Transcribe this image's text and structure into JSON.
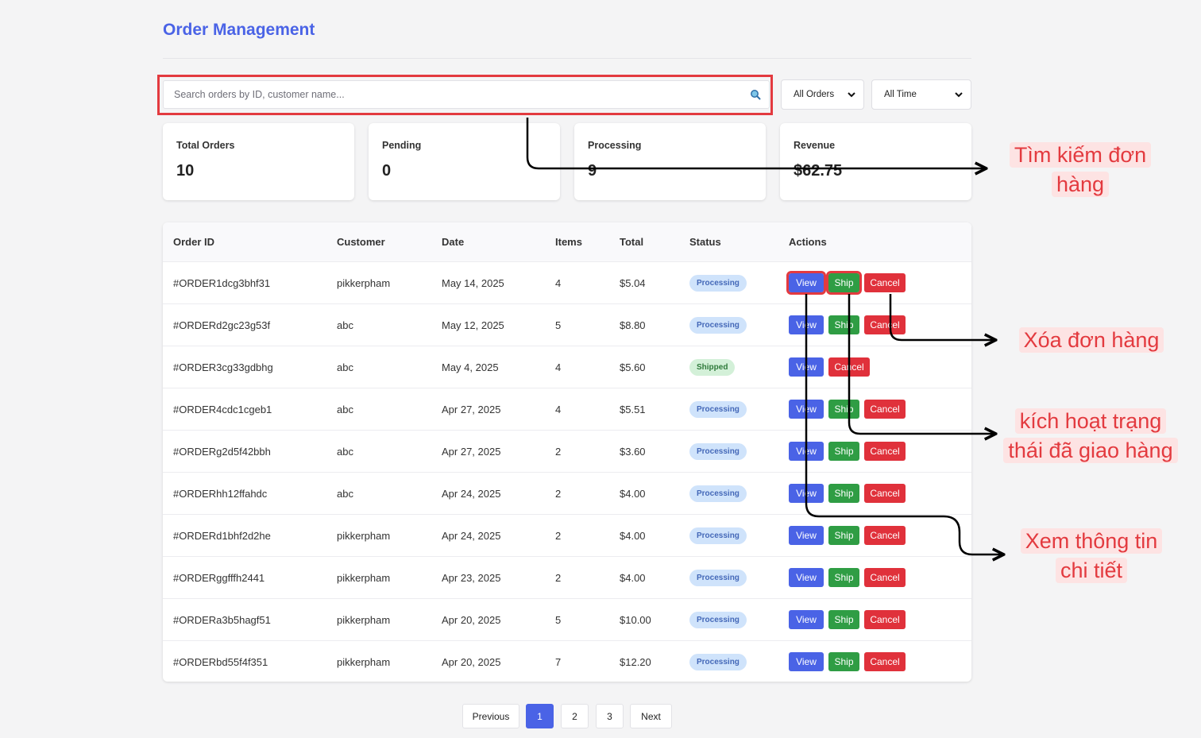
{
  "page": {
    "title": "Order Management"
  },
  "search": {
    "placeholder": "Search orders by ID, customer name...",
    "value": ""
  },
  "filters": {
    "status": "All Orders",
    "time": "All Time"
  },
  "stats": [
    {
      "label": "Total Orders",
      "value": "10"
    },
    {
      "label": "Pending",
      "value": "0"
    },
    {
      "label": "Processing",
      "value": "9"
    },
    {
      "label": "Revenue",
      "value": "$62.75"
    }
  ],
  "table": {
    "columns": [
      "Order ID",
      "Customer",
      "Date",
      "Items",
      "Total",
      "Status",
      "Actions"
    ],
    "actions": {
      "view": "View",
      "ship": "Ship",
      "cancel": "Cancel"
    },
    "rows": [
      {
        "id": "#ORDER1dcg3bhf31",
        "customer": "pikkerpham",
        "date": "May 14, 2025",
        "items": "4",
        "total": "$5.04",
        "status": "Processing"
      },
      {
        "id": "#ORDERd2gc23g53f",
        "customer": "abc",
        "date": "May 12, 2025",
        "items": "5",
        "total": "$8.80",
        "status": "Processing"
      },
      {
        "id": "#ORDER3cg33gdbhg",
        "customer": "abc",
        "date": "May 4, 2025",
        "items": "4",
        "total": "$5.60",
        "status": "Shipped"
      },
      {
        "id": "#ORDER4cdc1cgeb1",
        "customer": "abc",
        "date": "Apr 27, 2025",
        "items": "4",
        "total": "$5.51",
        "status": "Processing"
      },
      {
        "id": "#ORDERg2d5f42bbh",
        "customer": "abc",
        "date": "Apr 27, 2025",
        "items": "2",
        "total": "$3.60",
        "status": "Processing"
      },
      {
        "id": "#ORDERhh12ffahdc",
        "customer": "abc",
        "date": "Apr 24, 2025",
        "items": "2",
        "total": "$4.00",
        "status": "Processing"
      },
      {
        "id": "#ORDERd1bhf2d2he",
        "customer": "pikkerpham",
        "date": "Apr 24, 2025",
        "items": "2",
        "total": "$4.00",
        "status": "Processing"
      },
      {
        "id": "#ORDERggfffh2441",
        "customer": "pikkerpham",
        "date": "Apr 23, 2025",
        "items": "2",
        "total": "$4.00",
        "status": "Processing"
      },
      {
        "id": "#ORDERa3b5hagf51",
        "customer": "pikkerpham",
        "date": "Apr 20, 2025",
        "items": "5",
        "total": "$10.00",
        "status": "Processing"
      },
      {
        "id": "#ORDERbd55f4f351",
        "customer": "pikkerpham",
        "date": "Apr 20, 2025",
        "items": "7",
        "total": "$12.20",
        "status": "Processing"
      }
    ]
  },
  "pagination": {
    "previous": "Previous",
    "pages": [
      "1",
      "2",
      "3"
    ],
    "current": "1",
    "next": "Next"
  },
  "annotations": {
    "search": [
      "Tìm kiếm đơn",
      "hàng"
    ],
    "cancel": [
      "Xóa đơn hàng"
    ],
    "ship": [
      "kích hoạt trạng",
      "thái đã giao hàng"
    ],
    "view": [
      "Xem thông tin",
      "chi tiết"
    ]
  },
  "colors": {
    "accent": "#4a63e6",
    "ship": "#2f9d44",
    "cancel": "#e0313b",
    "annotation": "#e33a3f"
  }
}
